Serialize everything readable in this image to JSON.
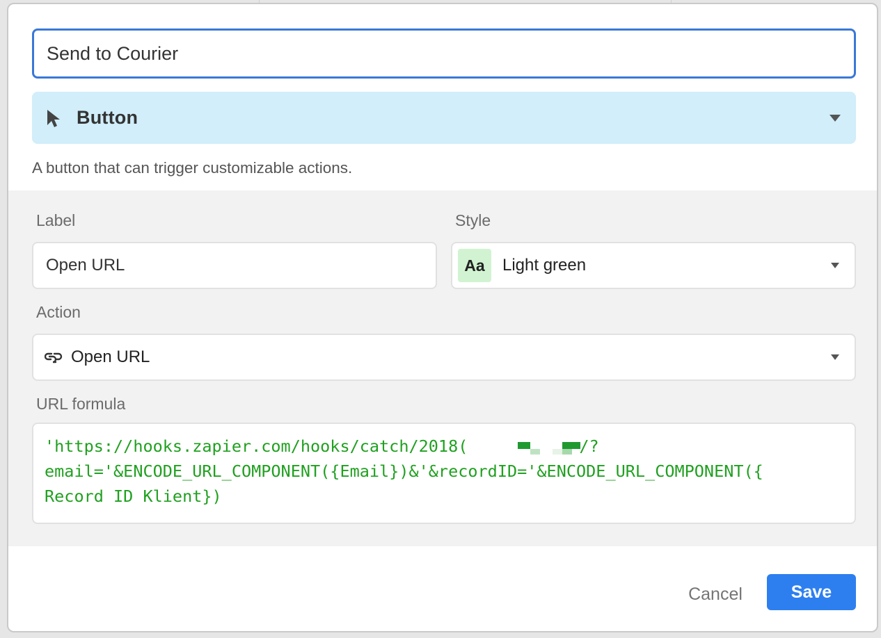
{
  "field_name": {
    "value": "Send to Courier"
  },
  "field_type": {
    "icon": "cursor-arrow-icon",
    "label": "Button",
    "description": "A button that can trigger customizable actions."
  },
  "label_field": {
    "title": "Label",
    "value": "Open URL"
  },
  "style_field": {
    "title": "Style",
    "swatch_text": "Aa",
    "swatch_color": "#d1f3d1",
    "value": "Light green"
  },
  "action_field": {
    "title": "Action",
    "icon": "link-icon",
    "value": "Open URL"
  },
  "url_formula": {
    "title": "URL formula",
    "line1_start": "'https://hooks.zapier.com/hooks/catch/2018(",
    "line1_end": "/?",
    "line2": "email='&ENCODE_URL_COMPONENT({Email})&'&recordID='&ENCODE_URL_COMPONENT({",
    "line3": "Record ID Klient})",
    "text_color": "#20a020"
  },
  "footer": {
    "cancel_label": "Cancel",
    "save_label": "Save",
    "save_color": "#2d7ff0"
  }
}
